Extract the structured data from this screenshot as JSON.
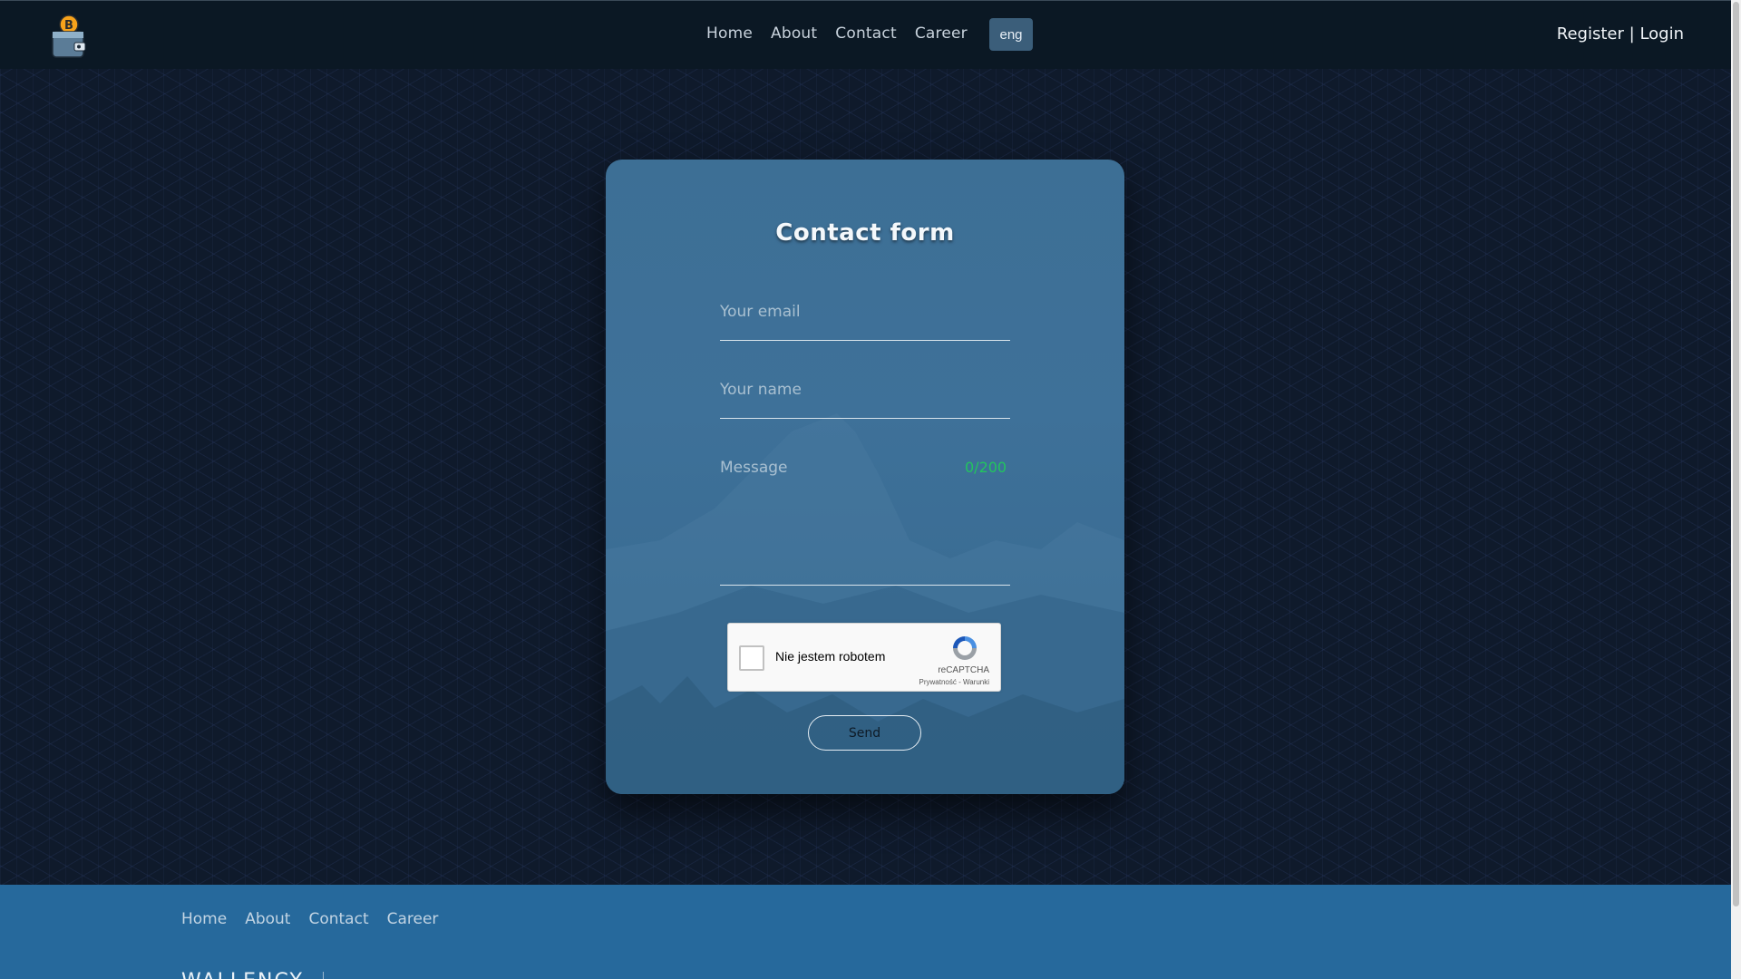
{
  "header": {
    "nav": [
      "Home",
      "About",
      "Contact",
      "Career"
    ],
    "lang": "eng",
    "register": "Register",
    "separator": "|",
    "login": "Login"
  },
  "form": {
    "title": "Contact form",
    "email_placeholder": "Your email",
    "name_placeholder": "Your name",
    "message_placeholder": "Message",
    "counter": "0/200",
    "recaptcha_label": "Nie jestem robotem",
    "recaptcha_brand": "reCAPTCHA",
    "recaptcha_links": "Prywatność - Warunki",
    "send_label": "Send"
  },
  "footer": {
    "nav": [
      "Home",
      "About",
      "Contact",
      "Career"
    ],
    "brand": "WALLENCY"
  },
  "colors": {
    "accent": "#26699c",
    "card": "#3d6f95",
    "counter": "#22c55e"
  }
}
